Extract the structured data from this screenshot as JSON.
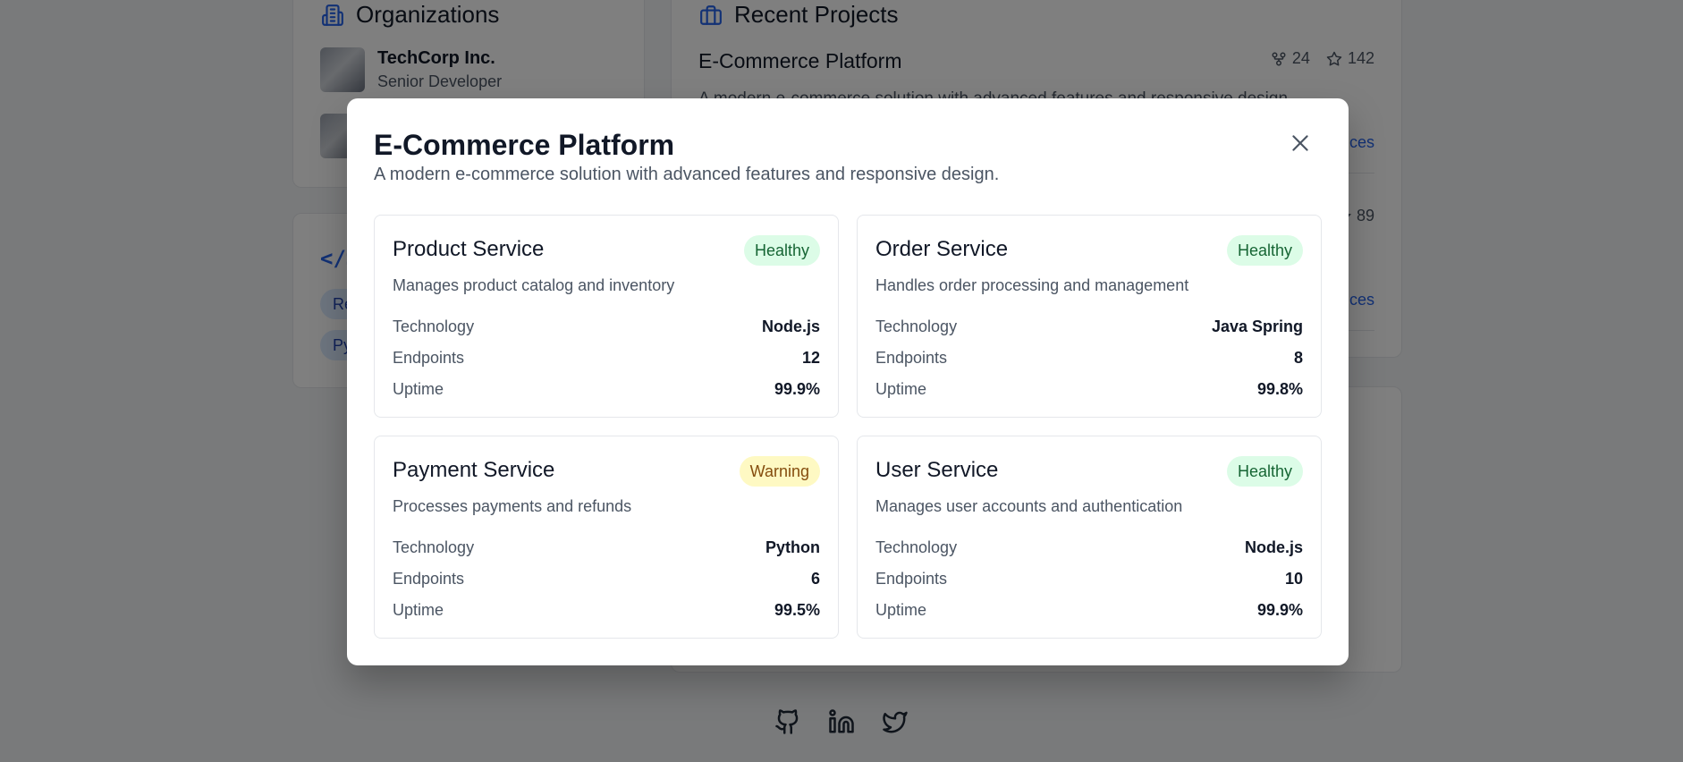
{
  "background": {
    "organizations": {
      "title": "Organizations",
      "items": [
        {
          "name": "TechCorp Inc.",
          "role": "Senior Developer"
        }
      ]
    },
    "skills": {
      "pills": [
        "Re",
        "Py"
      ]
    },
    "projects": {
      "title": "Recent Projects",
      "items": [
        {
          "name": "E-Commerce Platform",
          "forks": "24",
          "stars": "142",
          "description": "A modern e-commerce solution with advanced features and responsive design.",
          "link": "ices"
        },
        {
          "stars": "89",
          "link": "ices"
        }
      ]
    },
    "social": [
      "github-icon",
      "linkedin-icon",
      "twitter-icon"
    ]
  },
  "modal": {
    "title": "E-Commerce Platform",
    "subtitle": "A modern e-commerce solution with advanced features and responsive design.",
    "labels": {
      "technology": "Technology",
      "endpoints": "Endpoints",
      "uptime": "Uptime"
    },
    "services": [
      {
        "name": "Product Service",
        "status": "Healthy",
        "description": "Manages product catalog and inventory",
        "technology": "Node.js",
        "endpoints": "12",
        "uptime": "99.9%"
      },
      {
        "name": "Order Service",
        "status": "Healthy",
        "description": "Handles order processing and management",
        "technology": "Java Spring",
        "endpoints": "8",
        "uptime": "99.8%"
      },
      {
        "name": "Payment Service",
        "status": "Warning",
        "description": "Processes payments and refunds",
        "technology": "Python",
        "endpoints": "6",
        "uptime": "99.5%"
      },
      {
        "name": "User Service",
        "status": "Healthy",
        "description": "Manages user accounts and authentication",
        "technology": "Node.js",
        "endpoints": "10",
        "uptime": "99.9%"
      }
    ]
  },
  "colors": {
    "accent": "#2563eb",
    "healthy_bg": "#dcfce7",
    "healthy_text": "#166534",
    "warning_bg": "#fef9c3",
    "warning_text": "#854d0e"
  }
}
